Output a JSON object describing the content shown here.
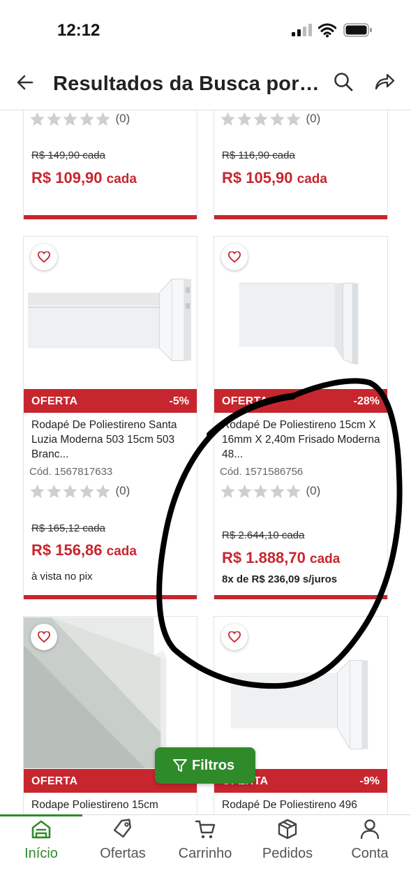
{
  "status_bar": {
    "time": "12:12"
  },
  "header": {
    "title": "Resultados da Busca por…"
  },
  "products": [
    {
      "old_price": "R$ 149,90 cada",
      "price": "R$ 109,90",
      "unit": "cada",
      "rating_count": "(0)"
    },
    {
      "old_price": "R$ 116,90 cada",
      "price": "R$ 105,90",
      "unit": "cada",
      "rating_count": "(0)"
    },
    {
      "offer_label": "OFERTA",
      "discount": "-5%",
      "name": "Rodapé De Poliestireno Santa Luzia Moderna 503 15cm 503 Branc...",
      "code": "Cód. 1567817633",
      "rating_count": "(0)",
      "old_price": "R$ 165,12 cada",
      "price": "R$ 156,86",
      "unit": "cada",
      "extra": "à vista no pix"
    },
    {
      "offer_label": "OFERTA",
      "discount": "-28%",
      "name": "Rodapé De Poliestireno 15cm X 16mm X 2,40m Frisado Moderna 48...",
      "code": "Cód. 1571586756",
      "rating_count": "(0)",
      "old_price": "R$ 2.644,10 cada",
      "price": "R$ 1.888,70",
      "unit": "cada",
      "extra": "8x de R$ 236,09 s/juros"
    },
    {
      "offer_label": "OFERTA",
      "discount": "",
      "name": "Rodape Poliestireno 15cm"
    },
    {
      "offer_label": "OFERTA",
      "discount": "-9%",
      "name": "Rodapé De Poliestireno 496"
    }
  ],
  "filter_button": {
    "label": "Filtros"
  },
  "bottom_nav": [
    {
      "label": "Início",
      "icon": "home-icon",
      "active": true
    },
    {
      "label": "Ofertas",
      "icon": "tag-icon",
      "active": false
    },
    {
      "label": "Carrinho",
      "icon": "cart-icon",
      "active": false
    },
    {
      "label": "Pedidos",
      "icon": "box-icon",
      "active": false
    },
    {
      "label": "Conta",
      "icon": "user-icon",
      "active": false
    }
  ],
  "colors": {
    "accent_red": "#c7262e",
    "brand_green": "#2f8a2a",
    "annotation": "#000000"
  }
}
